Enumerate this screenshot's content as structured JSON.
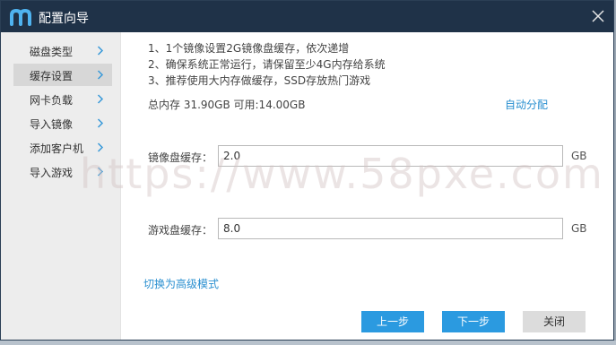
{
  "window": {
    "title": "配置向导",
    "close_icon": "close-icon"
  },
  "sidebar": {
    "items": [
      {
        "label": "磁盘类型",
        "active": false
      },
      {
        "label": "缓存设置",
        "active": true
      },
      {
        "label": "网卡负载",
        "active": false
      },
      {
        "label": "导入镜像",
        "active": false
      },
      {
        "label": "添加客户机",
        "active": false
      },
      {
        "label": "导入游戏",
        "active": false
      }
    ]
  },
  "tips": [
    "1、1个镜像设置2G镜像盘缓存，依次递增",
    "2、确保系统正常运行，请保留至少4G内存给系统",
    "3、推荐使用大内存做缓存，SSD存放热门游戏"
  ],
  "memory": {
    "summary": "总内存 31.90GB  可用:14.00GB",
    "auto_allocate": "自动分配"
  },
  "fields": {
    "image_cache": {
      "label": "镜像盘缓存：",
      "value": "2.0",
      "unit": "GB"
    },
    "game_cache": {
      "label": "游戏盘缓存：",
      "value": "8.0",
      "unit": "GB"
    }
  },
  "advanced_link": "切换为高级模式",
  "buttons": {
    "prev": "上一步",
    "next": "下一步",
    "close": "关闭"
  },
  "watermark": "https://www.58pxe.com",
  "colors": {
    "titlebar": "#1f3248",
    "accent": "#2b9ae0",
    "link": "#2a8fd0",
    "sidebar_bg": "#ededed",
    "sidebar_active": "#d7d7d7",
    "chevron": "#3a9ad9"
  }
}
